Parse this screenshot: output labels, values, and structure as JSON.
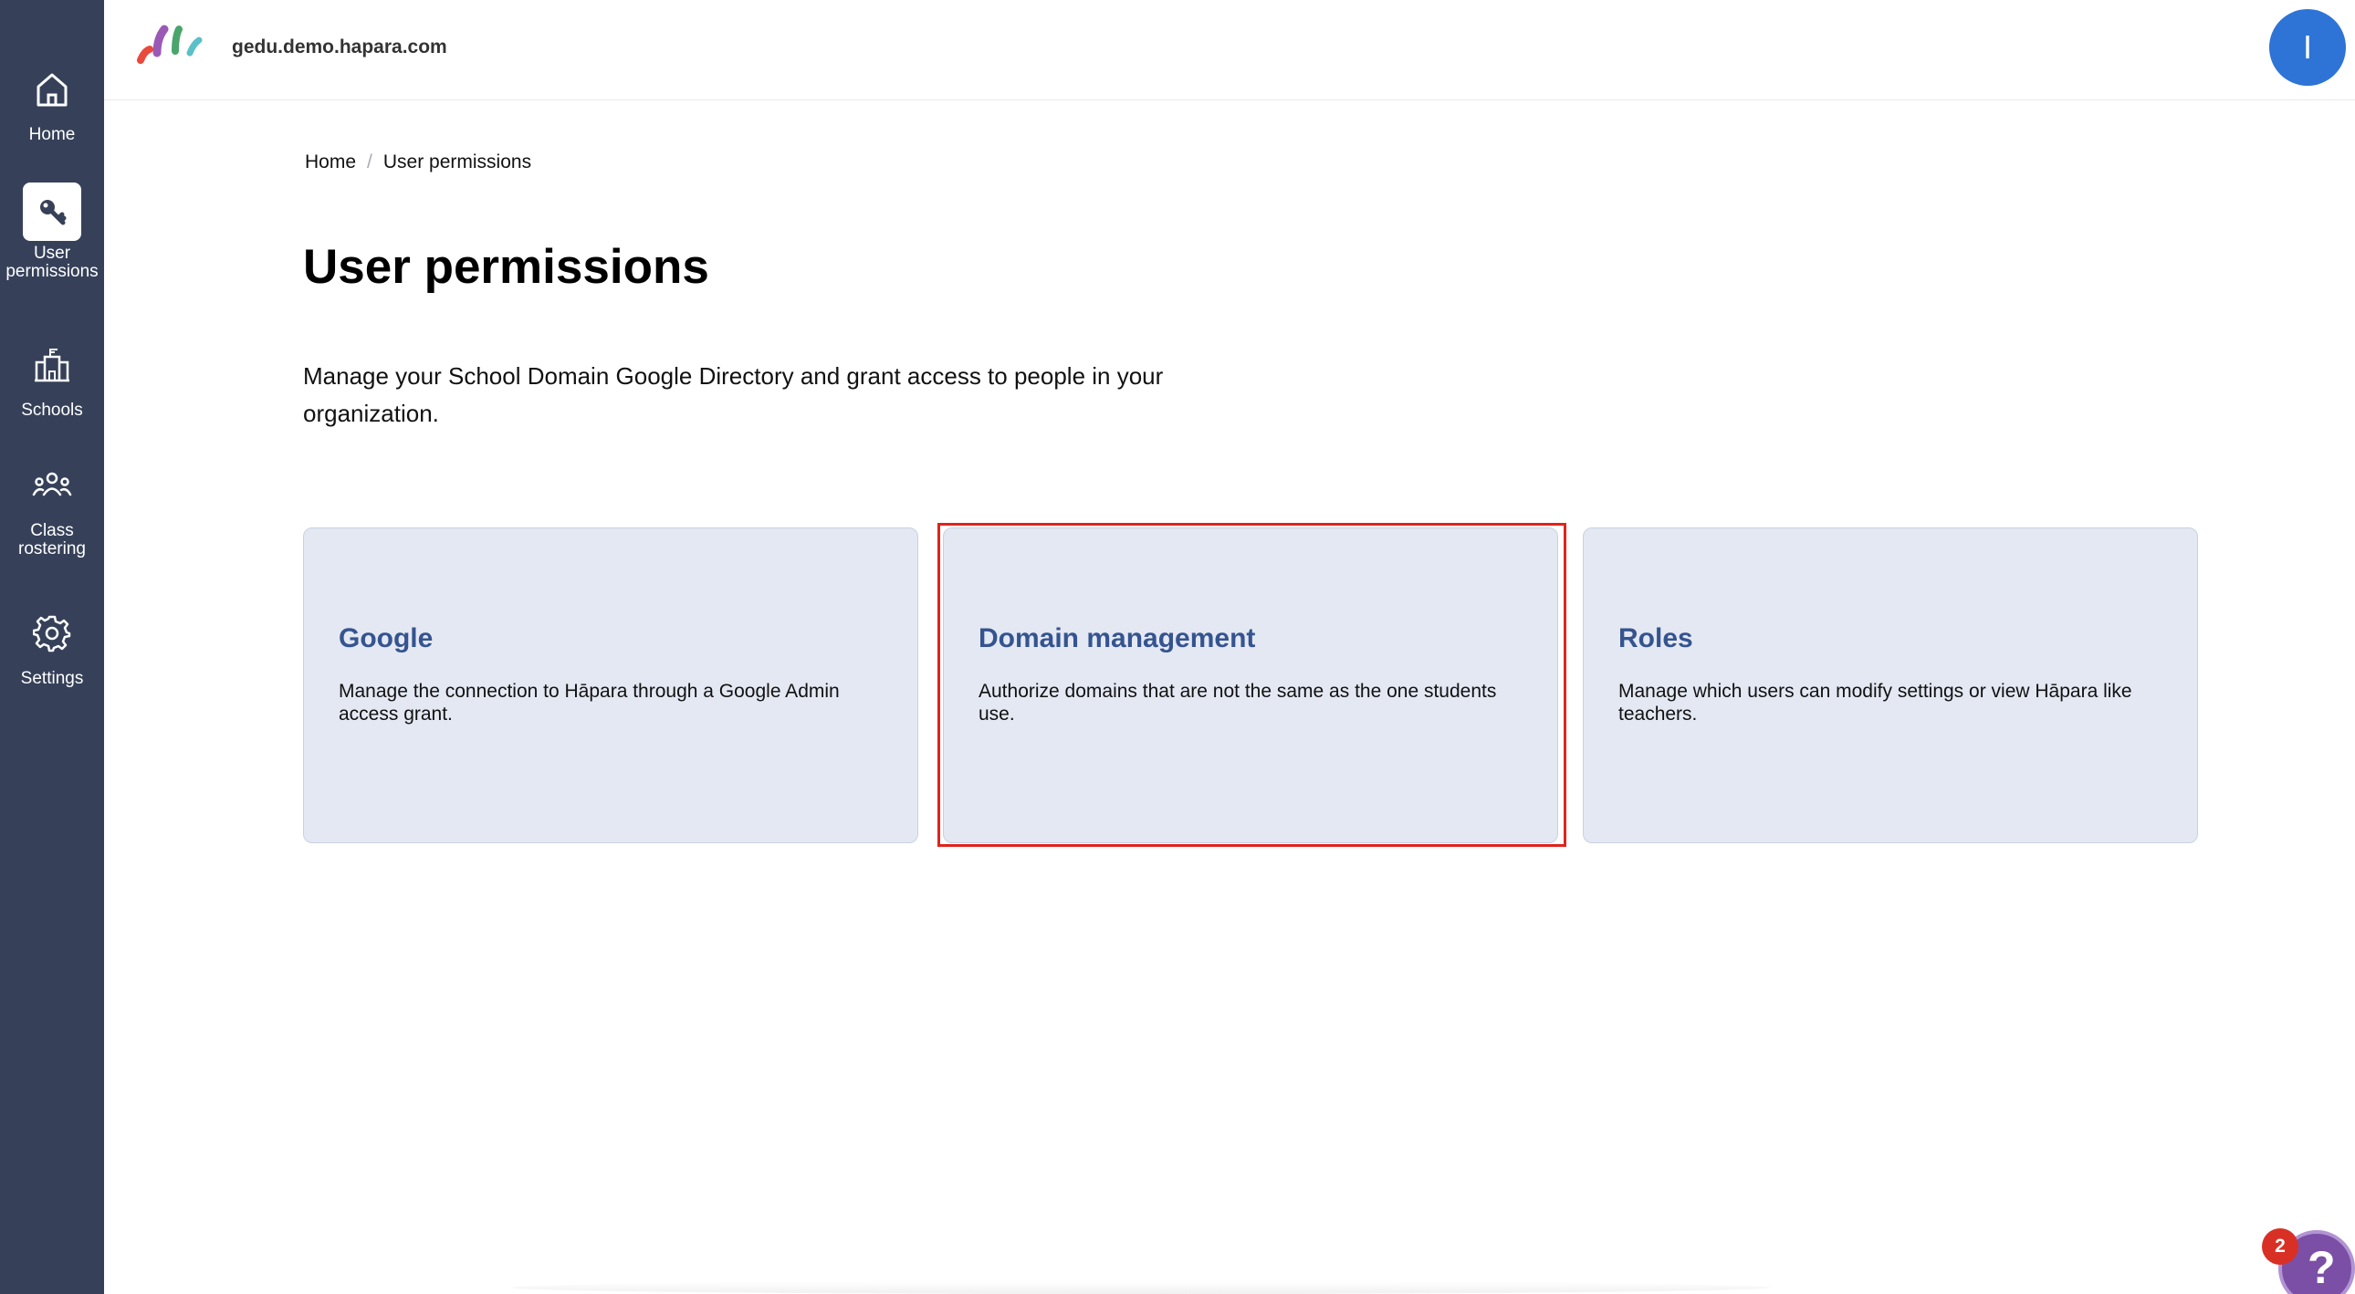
{
  "sidebar": {
    "items": [
      {
        "label": "Home",
        "icon": "home-icon"
      },
      {
        "label": "User\npermissions",
        "icon": "key-icon",
        "active": true
      },
      {
        "label": "Schools",
        "icon": "school-icon"
      },
      {
        "label": "Class\nrostering",
        "icon": "people-icon"
      },
      {
        "label": "Settings",
        "icon": "gear-icon"
      }
    ]
  },
  "header": {
    "domain": "gedu.demo.hapara.com",
    "avatar_initial": "I"
  },
  "breadcrumb": {
    "home": "Home",
    "separator": "/",
    "current": "User permissions"
  },
  "page": {
    "title": "User permissions",
    "description": "Manage your School Domain Google Directory and grant access to people in your organization."
  },
  "cards": [
    {
      "title": "Google",
      "description": "Manage the connection to Hāpara through a Google Admin access grant."
    },
    {
      "title": "Domain management",
      "description": "Authorize domains that are not the same as the one students use."
    },
    {
      "title": "Roles",
      "description": "Manage which users can modify settings or view Hāpara like teachers."
    }
  ],
  "help": {
    "glyph": "?",
    "badge_count": "2"
  },
  "colors": {
    "sidebar_bg": "#364159",
    "card_bg": "#e4e8f3",
    "card_title": "#35548f",
    "highlight": "#e0231c",
    "avatar_bg": "#2d74d6"
  }
}
